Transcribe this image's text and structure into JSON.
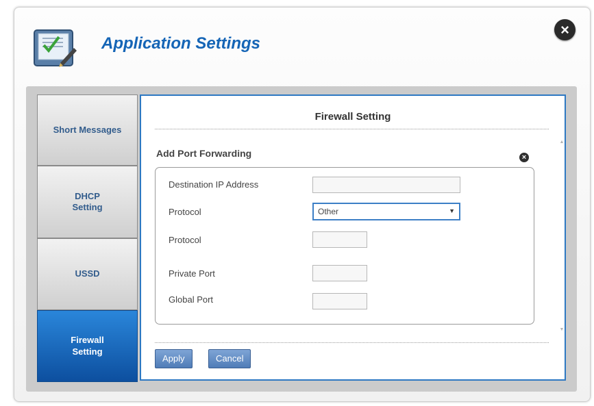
{
  "window": {
    "title": "Application Settings"
  },
  "sidebar": {
    "items": [
      {
        "label": "Short Messages"
      },
      {
        "label": "DHCP\nSetting"
      },
      {
        "label": "USSD"
      },
      {
        "label": "Firewall\nSetting"
      }
    ],
    "active_index": 3
  },
  "panel": {
    "title": "Firewall Setting",
    "section_title": "Add Port Forwarding",
    "fields": {
      "destination_ip": {
        "label": "Destination IP Address",
        "value": ""
      },
      "protocol_select": {
        "label": "Protocol",
        "value": "Other"
      },
      "protocol_custom": {
        "label": "Protocol",
        "value": ""
      },
      "private_port": {
        "label": "Private Port",
        "value": ""
      },
      "global_port": {
        "label": "Global Port",
        "value": ""
      }
    },
    "buttons": {
      "apply": "Apply",
      "cancel": "Cancel"
    }
  },
  "icons": {
    "close": "close-icon",
    "app": "application-settings-icon"
  },
  "colors": {
    "accent": "#1565b6",
    "active_tab": "#0d4f9f",
    "panel_border": "#2d78c2"
  }
}
